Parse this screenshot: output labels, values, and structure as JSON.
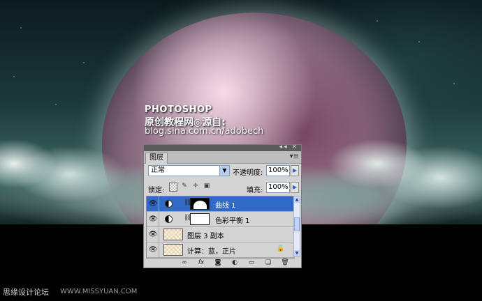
{
  "watermark": {
    "brand": "PHOTOSHOP",
    "line2": "原创教程网◎源自:",
    "url": "blog.sina.com.cn/adobech",
    "bottom_left": "思缘设计论坛",
    "bottom_url": "WWW.MISSYUAN.COM"
  },
  "panel": {
    "title_icons": "◂◂ ×",
    "tab": "图层",
    "menu_icon": "▾≡",
    "blend_mode": "正常",
    "opacity_label": "不透明度:",
    "opacity_value": "100%",
    "lock_label": "锁定:",
    "fill_label": "填充:",
    "fill_value": "100%",
    "layers": [
      {
        "name": "曲线 1",
        "selected": true
      },
      {
        "name": "色彩平衡 1",
        "selected": false
      },
      {
        "name": "图层 3 副本",
        "selected": false
      },
      {
        "name": "计算：蓝，正片",
        "selected": false
      }
    ]
  },
  "icons": {
    "eye": "eye-icon",
    "adjustment": "adjustment-layer-icon",
    "chain": "link-icon",
    "lock": "lock-icon"
  }
}
